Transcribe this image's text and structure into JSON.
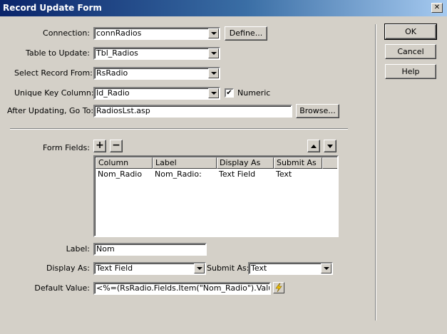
{
  "window": {
    "title": "Record Update Form",
    "close_glyph": "✕"
  },
  "form": {
    "connection_label": "Connection:",
    "connection_value": "connRadios",
    "define_button": "Define...",
    "table_label": "Table to Update:",
    "table_value": "Tbl_Radios",
    "select_record_label": "Select Record From:",
    "select_record_value": "RsRadio",
    "unique_key_label": "Unique Key Column:",
    "unique_key_value": "Id_Radio",
    "numeric_label": "Numeric",
    "numeric_checked": "✔",
    "after_update_label": "After Updating, Go To:",
    "after_update_value": "RadiosLst.asp",
    "browse_button": "Browse..."
  },
  "side_buttons": {
    "ok": "OK",
    "cancel": "Cancel",
    "help": "Help"
  },
  "fields": {
    "label": "Form Fields:",
    "add_glyph": "+",
    "remove_glyph": "−",
    "columns": [
      "Column",
      "Label",
      "Display As",
      "Submit As"
    ],
    "rows": [
      [
        "Nom_Radio",
        "Nom_Radio:",
        "Text Field",
        "Text"
      ]
    ]
  },
  "detail": {
    "label_label": "Label:",
    "label_value": "Nom",
    "display_as_label": "Display As:",
    "display_as_value": "Text Field",
    "submit_as_label": "Submit As:",
    "submit_as_value": "Text",
    "default_value_label": "Default Value:",
    "default_value": "<%=(RsRadio.Fields.Item(\"Nom_Radio\").Value)%"
  }
}
